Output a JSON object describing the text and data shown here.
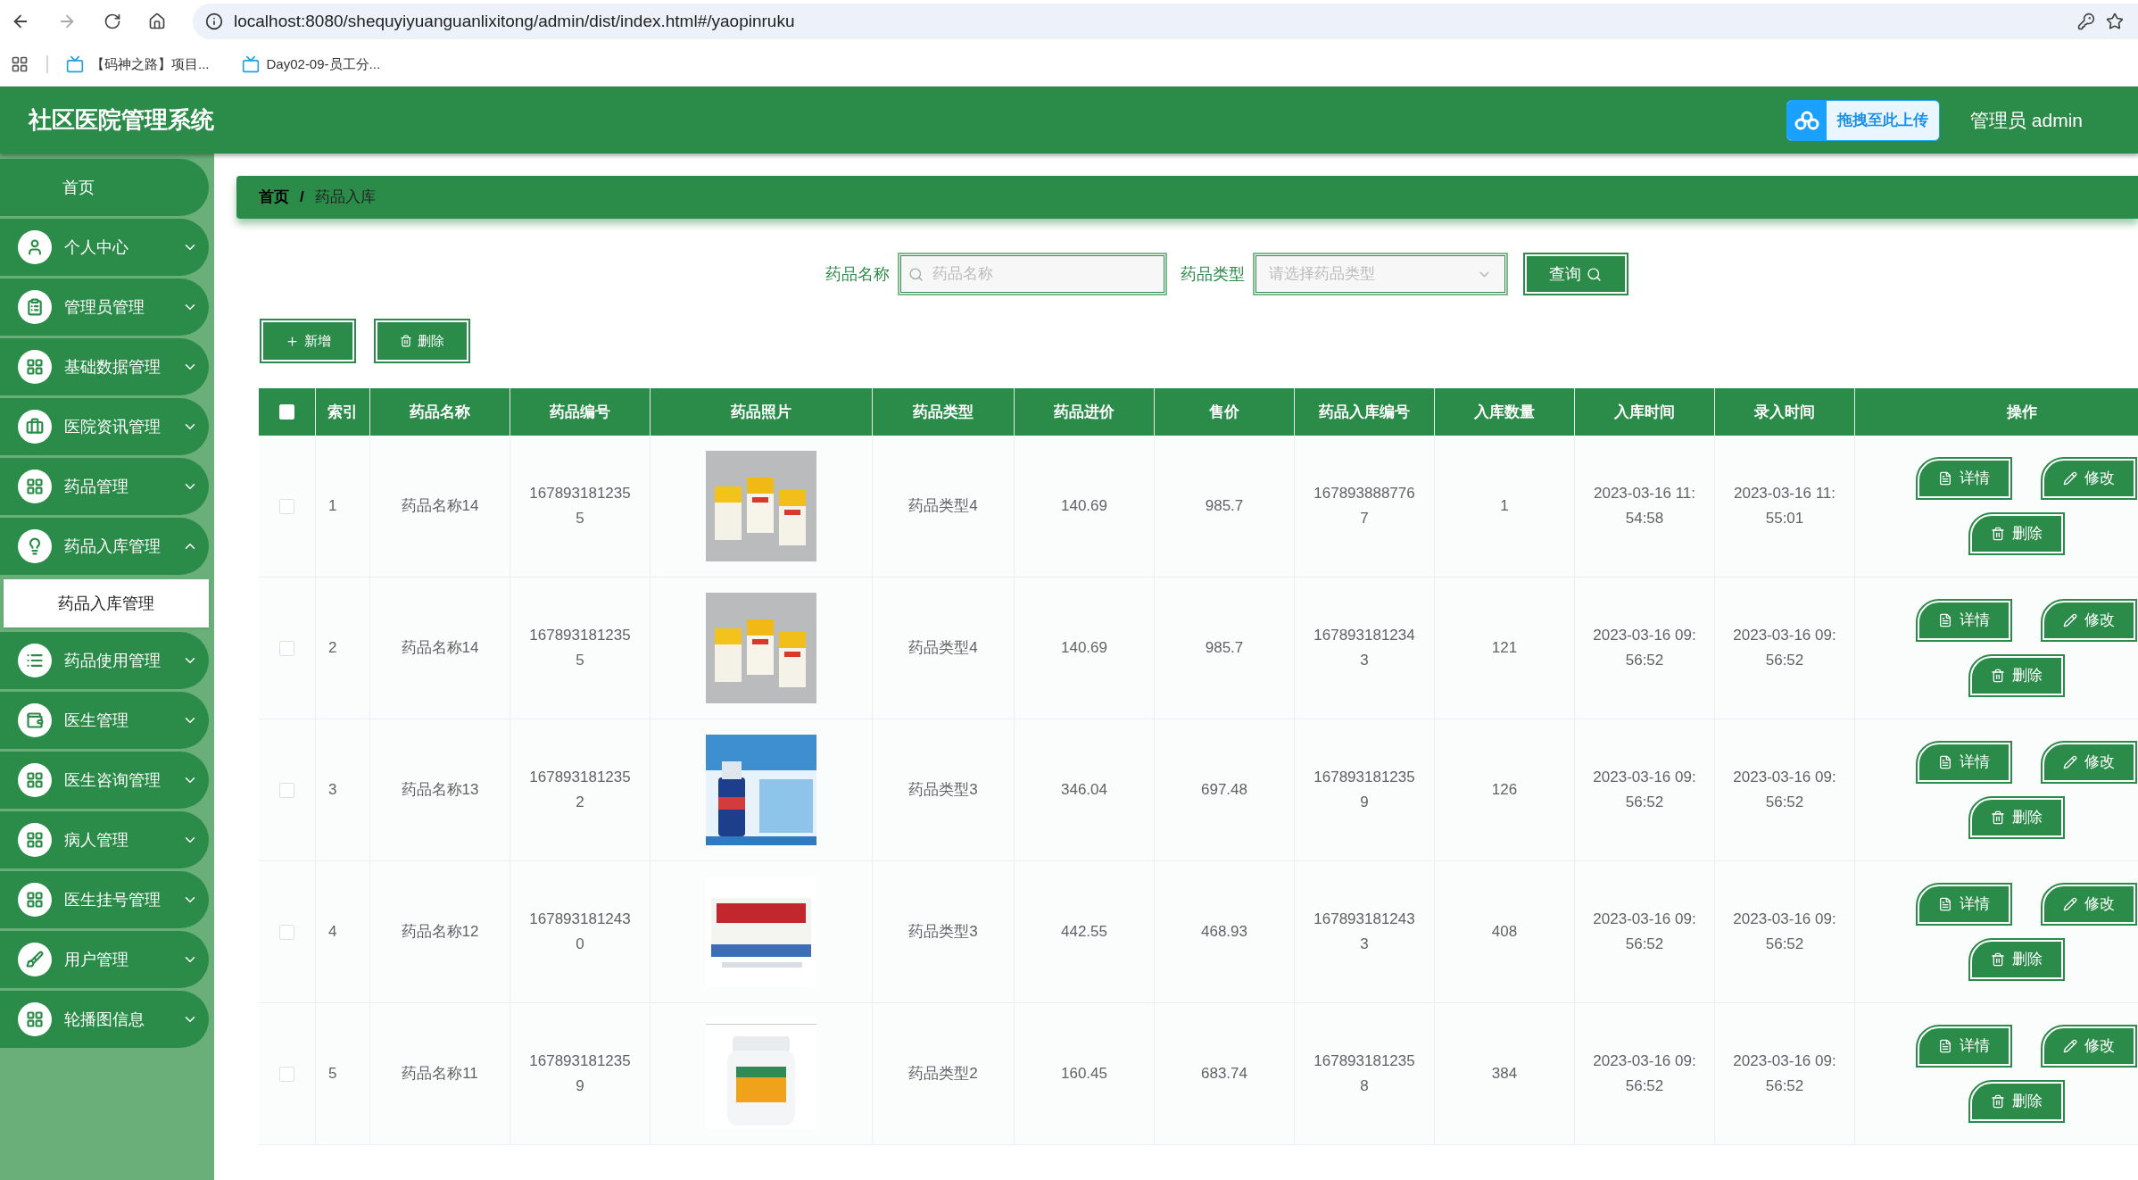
{
  "browser": {
    "url": "localhost:8080/shequyiyuanguanlixitong/admin/dist/index.html#/yaopinruku",
    "bookmarks": [
      "【码神之路】项目...",
      "Day02-09-员工分..."
    ]
  },
  "header": {
    "title": "社区医院管理系统",
    "upload_badge": "拖拽至此上传",
    "user": "管理员 admin"
  },
  "sidebar": {
    "items": [
      {
        "label": "首页",
        "kind": "link"
      },
      {
        "label": "个人中心",
        "kind": "menu",
        "expanded": false
      },
      {
        "label": "管理员管理",
        "kind": "menu",
        "expanded": false
      },
      {
        "label": "基础数据管理",
        "kind": "menu",
        "expanded": false
      },
      {
        "label": "医院资讯管理",
        "kind": "menu",
        "expanded": false
      },
      {
        "label": "药品管理",
        "kind": "menu",
        "expanded": false
      },
      {
        "label": "药品入库管理",
        "kind": "menu",
        "expanded": true,
        "children": [
          {
            "label": "药品入库管理",
            "selected": true
          }
        ]
      },
      {
        "label": "药品使用管理",
        "kind": "menu",
        "expanded": false
      },
      {
        "label": "医生管理",
        "kind": "menu",
        "expanded": false
      },
      {
        "label": "医生咨询管理",
        "kind": "menu",
        "expanded": false
      },
      {
        "label": "病人管理",
        "kind": "menu",
        "expanded": false
      },
      {
        "label": "医生挂号管理",
        "kind": "menu",
        "expanded": false
      },
      {
        "label": "用户管理",
        "kind": "menu",
        "expanded": false
      },
      {
        "label": "轮播图信息",
        "kind": "menu",
        "expanded": false
      }
    ]
  },
  "breadcrumb": {
    "items": [
      "首页",
      "药品入库"
    ],
    "separator": "/"
  },
  "search": {
    "fields": [
      {
        "label": "药品名称",
        "kind": "input",
        "placeholder": "药品名称"
      },
      {
        "label": "药品类型",
        "kind": "select",
        "placeholder": "请选择药品类型"
      }
    ],
    "button": "查询"
  },
  "toolbar": [
    {
      "label": "新增",
      "kind": "add"
    },
    {
      "label": "删除",
      "kind": "delete"
    }
  ],
  "table": {
    "select_all": {
      "checked": false
    },
    "columns": [
      "索引",
      "药品名称",
      "药品编号",
      "药品照片",
      "药品类型",
      "药品进价",
      "售价",
      "药品入库编号",
      "入库数量",
      "入库时间",
      "录入时间",
      "操作"
    ],
    "rows": [
      {
        "checked": false,
        "cells": [
          "1",
          "药品名称14",
          "1678931812355",
          {
            "kind": "picture"
          },
          "药品类型4",
          "140.69",
          "985.7",
          "1678938887767",
          "1",
          "2023-03-16 11:54:58",
          "2023-03-16 11:55:01"
        ],
        "actions": [
          {
            "label": "详情",
            "kind": "detail"
          },
          {
            "label": "修改",
            "kind": "edit"
          },
          {
            "label": "删除",
            "kind": "delete"
          }
        ]
      },
      {
        "checked": false,
        "cells": [
          "2",
          "药品名称14",
          "1678931812355",
          {
            "kind": "picture"
          },
          "药品类型4",
          "140.69",
          "985.7",
          "1678931812343",
          "121",
          "2023-03-16 09:56:52",
          "2023-03-16 09:56:52"
        ],
        "actions": [
          {
            "label": "详情",
            "kind": "detail"
          },
          {
            "label": "修改",
            "kind": "edit"
          },
          {
            "label": "删除",
            "kind": "delete"
          }
        ]
      },
      {
        "checked": false,
        "cells": [
          "3",
          "药品名称13",
          "1678931812352",
          {
            "kind": "picture"
          },
          "药品类型3",
          "346.04",
          "697.48",
          "1678931812359",
          "126",
          "2023-03-16 09:56:52",
          "2023-03-16 09:56:52"
        ],
        "actions": [
          {
            "label": "详情",
            "kind": "detail"
          },
          {
            "label": "修改",
            "kind": "edit"
          },
          {
            "label": "删除",
            "kind": "delete"
          }
        ]
      },
      {
        "checked": false,
        "cells": [
          "4",
          "药品名称12",
          "1678931812430",
          {
            "kind": "picture"
          },
          "药品类型3",
          "442.55",
          "468.93",
          "1678931812433",
          "408",
          "2023-03-16 09:56:52",
          "2023-03-16 09:56:52"
        ],
        "actions": [
          {
            "label": "详情",
            "kind": "detail"
          },
          {
            "label": "修改",
            "kind": "edit"
          },
          {
            "label": "删除",
            "kind": "delete"
          }
        ]
      },
      {
        "checked": false,
        "cells": [
          "5",
          "药品名称11",
          "1678931812359",
          {
            "kind": "picture"
          },
          "药品类型2",
          "160.45",
          "683.74",
          "1678931812358",
          "384",
          "2023-03-16 09:56:52",
          "2023-03-16 09:56:52"
        ],
        "actions": [
          {
            "label": "详情",
            "kind": "detail"
          },
          {
            "label": "修改",
            "kind": "edit"
          },
          {
            "label": "删除",
            "kind": "delete"
          }
        ]
      }
    ]
  }
}
